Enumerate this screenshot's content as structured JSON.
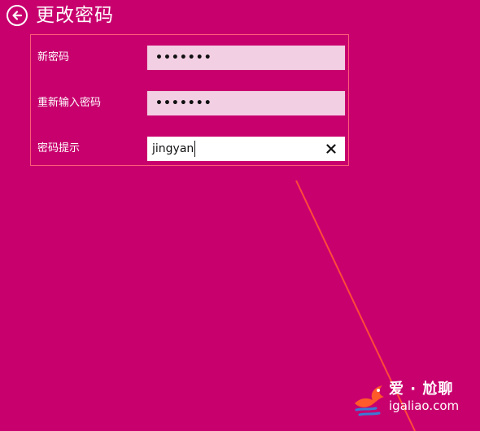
{
  "header": {
    "title": "更改密码"
  },
  "form": {
    "new_password": {
      "label": "新密码",
      "value": "•••••••"
    },
    "confirm_password": {
      "label": "重新输入密码",
      "value": "•••••••"
    },
    "password_hint": {
      "label": "密码提示",
      "value": "jingyan"
    }
  },
  "watermark": {
    "brand": "爱 · 尬聊",
    "url": "igaliao.com"
  },
  "icons": {
    "back": "back-arrow-circle-icon",
    "clear": "close-icon"
  },
  "colors": {
    "background": "#c8006e",
    "field_password": "#f3cfe4",
    "field_text": "#ffffff",
    "highlight_border": "#ff5a78",
    "annotation_line": "#ff4a3a"
  }
}
